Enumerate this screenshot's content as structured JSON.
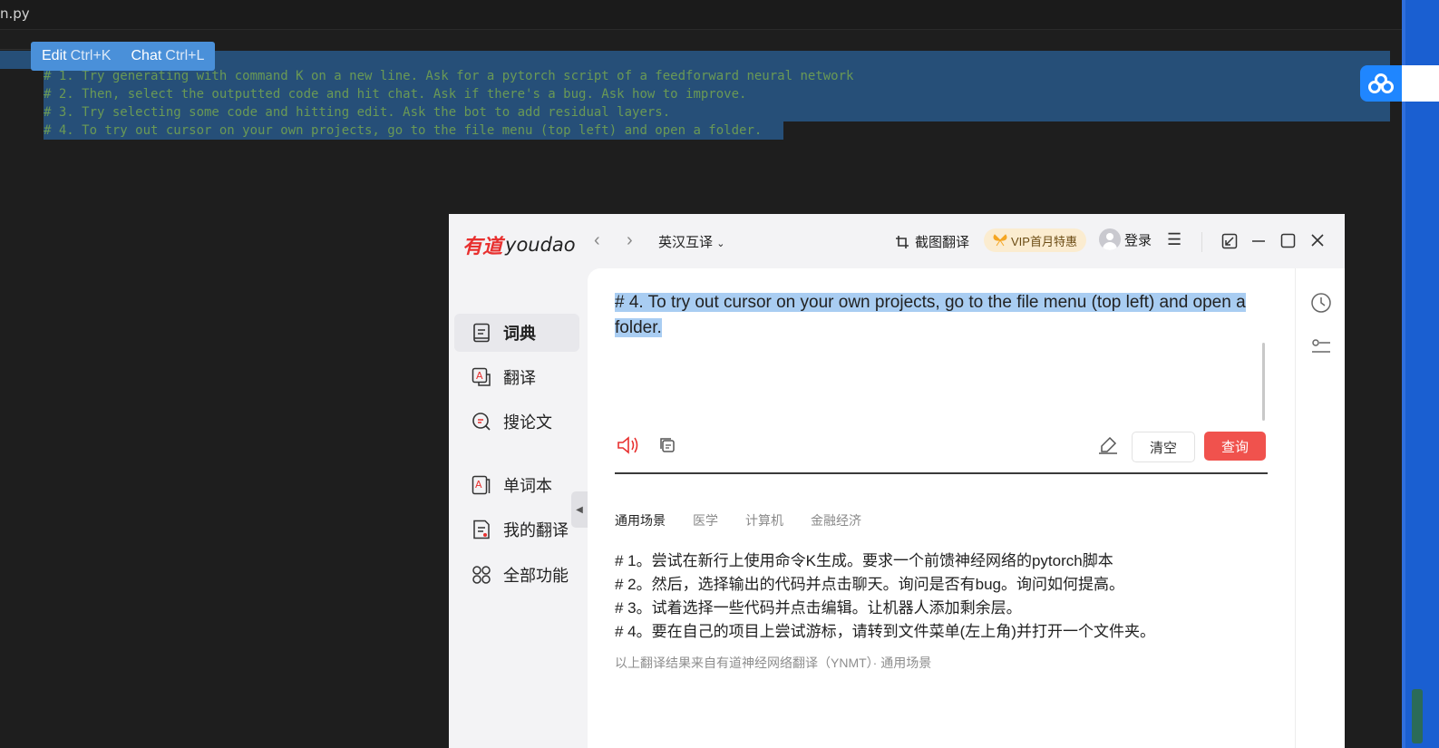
{
  "editor": {
    "tab_filename": "n.py",
    "hint": {
      "edit_label": "Edit",
      "edit_key": "Ctrl+K",
      "chat_label": "Chat",
      "chat_key": "Ctrl+L"
    },
    "lines": [
      "# 1. Try generating with command K on a new line. Ask for a pytorch script of a feedforward neural network",
      "# 2. Then, select the outputted code and hit chat. Ask if there's a bug. Ask how to improve.",
      "# 3. Try selecting some code and hitting edit. Ask the bot to add residual layers.",
      "# 4. To try out cursor on your own projects, go to the file menu (top left) and open a folder."
    ]
  },
  "youdao": {
    "logo_cn": "有道",
    "logo_en": "youdao",
    "mode": "英汉互译",
    "screenshot_translate": "截图翻译",
    "vip": "VIP首月特惠",
    "login": "登录",
    "sidebar": [
      "词典",
      "翻译",
      "搜论文",
      "单词本",
      "我的翻译",
      "全部功能"
    ],
    "input_text": "# 4. To try out cursor on your own projects, go to the file menu (top left) and open a folder.",
    "clear_label": "清空",
    "query_label": "查询",
    "scenes": [
      "通用场景",
      "医学",
      "计算机",
      "金融经济"
    ],
    "results": [
      "# 1。尝试在新行上使用命令K生成。要求一个前馈神经网络的pytorch脚本",
      "# 2。然后，选择输出的代码并点击聊天。询问是否有bug。询问如何提高。",
      "# 3。试着选择一些代码并点击编辑。让机器人添加剩余层。",
      "# 4。要在自己的项目上尝试游标，请转到文件菜单(左上角)并打开一个文件夹。"
    ],
    "source_note": "以上翻译结果来自有道神经网络翻译（YNMT）· 通用场景"
  },
  "colors": {
    "accent": "#f0524d",
    "selection": "#264f78",
    "comment": "#6a9955"
  }
}
